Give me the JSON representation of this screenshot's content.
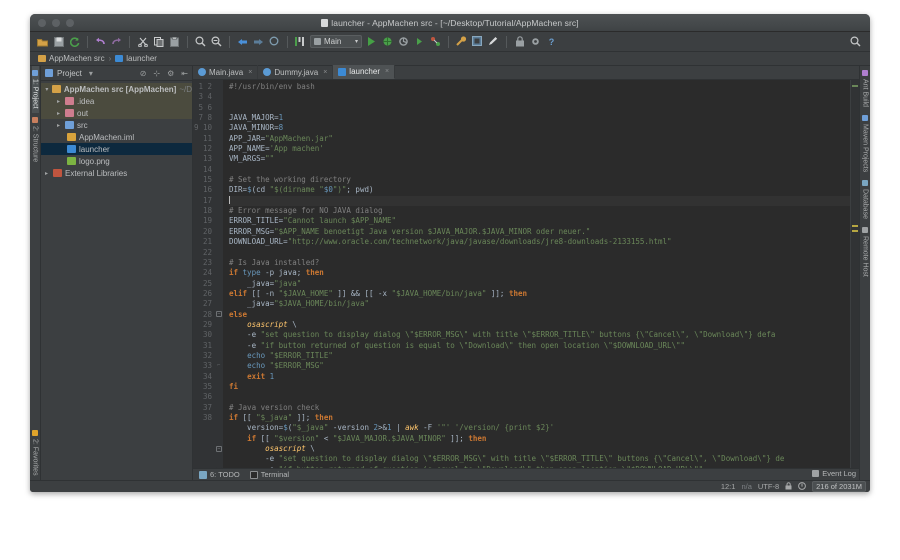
{
  "window": {
    "title": "launcher - AppMachen src - [~/Desktop/Tutorial/AppMachen src]",
    "title_icon": "file-icon"
  },
  "toolbar": {
    "icons": [
      {
        "name": "open-folder-icon",
        "glyph": "▤"
      },
      {
        "name": "save-all-icon",
        "glyph": "▣"
      },
      {
        "name": "sync-icon",
        "glyph": "⟳"
      },
      {
        "name": "undo-icon",
        "glyph": "↶"
      },
      {
        "name": "redo-icon",
        "glyph": "↷"
      },
      {
        "name": "cut-icon",
        "glyph": "✂"
      },
      {
        "name": "copy-icon",
        "glyph": "❐"
      },
      {
        "name": "paste-icon",
        "glyph": "📋"
      },
      {
        "name": "find-icon",
        "glyph": "🔍"
      },
      {
        "name": "replace-icon",
        "glyph": "🔎"
      },
      {
        "name": "back-icon",
        "glyph": "◀"
      },
      {
        "name": "forward-icon",
        "glyph": "▶"
      },
      {
        "name": "last-edit-icon",
        "glyph": "⊙"
      },
      {
        "name": "compile-icon",
        "glyph": "⫼"
      }
    ],
    "run_config": {
      "label": "Main",
      "caret": "▾"
    },
    "run_icons": [
      {
        "name": "run-icon",
        "glyph": "▶"
      },
      {
        "name": "debug-icon",
        "glyph": "⬤"
      },
      {
        "name": "run-coverage-icon",
        "glyph": "⛭"
      },
      {
        "name": "run-with-profiler-icon",
        "glyph": "▷"
      },
      {
        "name": "attach-process-icon",
        "glyph": "⚯"
      },
      {
        "name": "build-icon",
        "glyph": "⚒"
      },
      {
        "name": "sdk-settings-icon",
        "glyph": "▦"
      },
      {
        "name": "edit-icon",
        "glyph": "／"
      },
      {
        "name": "lock-icon",
        "glyph": "🔒"
      },
      {
        "name": "settings-icon",
        "glyph": "⚙"
      },
      {
        "name": "help-icon",
        "glyph": "?"
      },
      {
        "name": "search-everywhere-icon",
        "glyph": "🔍"
      }
    ]
  },
  "breadcrumb": [
    {
      "name": "breadcrumb-appmachen-src",
      "label": "AppMachen src",
      "icon": "folder-icon",
      "color": "#d4a147"
    },
    {
      "name": "breadcrumb-launcher",
      "label": "launcher",
      "icon": "file-icon",
      "color": "#3c8ad4"
    }
  ],
  "left_strip": [
    {
      "name": "tool-tab-project",
      "label": "1: Project",
      "active": true,
      "color": "#6f9fd8"
    },
    {
      "name": "tool-tab-structure",
      "label": "2: Structure",
      "active": false,
      "color": "#c87f5e"
    }
  ],
  "left_strip_bottom": [
    {
      "name": "tool-tab-favorites",
      "label": "2: Favorites",
      "icon": "star-icon",
      "color": "#e0a42b"
    }
  ],
  "right_strip": [
    {
      "name": "tool-tab-ant-build",
      "label": "Ant Build",
      "color": "#b07fd0"
    },
    {
      "name": "tool-tab-maven-projects",
      "label": "Maven Projects",
      "color": "#6f9fd8"
    },
    {
      "name": "tool-tab-database",
      "label": "Database",
      "color": "#7aa6c2"
    },
    {
      "name": "tool-tab-remote-host",
      "label": "Remote Host",
      "color": "#9fa2a4"
    }
  ],
  "project_panel": {
    "title": "Project",
    "caret": "▾",
    "actions": [
      {
        "name": "collapse-all-icon",
        "glyph": "⊘"
      },
      {
        "name": "locate-icon",
        "glyph": "⊹"
      },
      {
        "name": "settings-icon",
        "glyph": "⚙"
      },
      {
        "name": "hide-icon",
        "glyph": "⇤"
      }
    ],
    "tree": [
      {
        "name": "tree-item-appmachen-src",
        "label": "AppMachen src [AppMachen]",
        "suffix": "~/D",
        "indent": 0,
        "arrow": "▾",
        "icon": "module-folder-icon",
        "color": "#d4a147",
        "bold": true,
        "state": "highlight"
      },
      {
        "name": "tree-item-idea",
        "label": ".idea",
        "indent": 1,
        "arrow": "▸",
        "icon": "folder-icon",
        "color": "#cf7d8e",
        "state": "highlight"
      },
      {
        "name": "tree-item-out",
        "label": "out",
        "indent": 1,
        "arrow": "▸",
        "icon": "folder-icon",
        "color": "#cf7d8e",
        "state": "highlight"
      },
      {
        "name": "tree-item-src",
        "label": "src",
        "indent": 1,
        "arrow": "▸",
        "icon": "source-folder-icon",
        "color": "#6f9fd8",
        "state": "normal"
      },
      {
        "name": "tree-item-appmachen-iml",
        "label": "AppMachen.iml",
        "indent": 2,
        "arrow": "",
        "icon": "iml-file-icon",
        "color": "#d9a33c",
        "state": "normal"
      },
      {
        "name": "tree-item-launcher",
        "label": "launcher",
        "indent": 2,
        "arrow": "",
        "icon": "file-icon",
        "color": "#3c8ad4",
        "state": "selected"
      },
      {
        "name": "tree-item-logo-png",
        "label": "logo.png",
        "indent": 2,
        "arrow": "",
        "icon": "image-file-icon",
        "color": "#7cb342",
        "state": "normal"
      },
      {
        "name": "tree-item-external-libraries",
        "label": "External Libraries",
        "indent": 0,
        "arrow": "▸",
        "icon": "libraries-icon",
        "color": "#c0553f",
        "state": "normal"
      }
    ]
  },
  "editor_tabs": [
    {
      "name": "tab-main-java",
      "label": "Main.java",
      "icon": "java-class-icon",
      "active": false,
      "close": "×"
    },
    {
      "name": "tab-dummy-java",
      "label": "Dummy.java",
      "icon": "java-class-icon",
      "active": false,
      "close": "×"
    },
    {
      "name": "tab-launcher",
      "label": "launcher",
      "icon": "shell-file-icon",
      "active": true,
      "close": "×"
    }
  ],
  "editor": {
    "first_line": 1,
    "last_line": 38,
    "current_line": 12,
    "lines": [
      "#!/usr/bin/env bash",
      "",
      "",
      "JAVA_MAJOR=1",
      "JAVA_MINOR=8",
      "APP_JAR=\"AppMachen.jar\"",
      "APP_NAME='App machen'",
      "VM_ARGS=\"\"",
      "",
      "# Set the working directory",
      "DIR=$(cd \"$(dirname \"$0\")\"; pwd)",
      "",
      "# Error message for NO JAVA dialog",
      "ERROR_TITLE=\"Cannot launch $APP_NAME\"",
      "ERROR_MSG=\"$APP_NAME benoetigt Java version $JAVA_MAJOR.$JAVA_MINOR oder neuer.\"",
      "DOWNLOAD_URL=\"http://www.oracle.com/technetwork/java/javase/downloads/jre8-downloads-2133155.html\"",
      "",
      "# Is Java installed?",
      "if type -p java; then",
      "    _java=\"java\"",
      "elif [[ -n \"$JAVA_HOME\" ]] && [[ -x \"$JAVA_HOME/bin/java\" ]]; then",
      "    _java=\"$JAVA_HOME/bin/java\"",
      "else",
      "    osascript \\",
      "    -e \"set question to display dialog \\\"$ERROR_MSG\\\" with title \\\"$ERROR_TITLE\\\" buttons {\\\"Cancel\\\", \\\"Download\\\"} defa",
      "    -e \"if button returned of question is equal to \\\"Download\\\" then open location \\\"$DOWNLOAD_URL\\\"\"",
      "    echo \"$ERROR_TITLE\"",
      "    echo \"$ERROR_MSG\"",
      "    exit 1",
      "fi",
      "",
      "# Java version check",
      "if [[ \"$_java\" ]]; then",
      "    version=$(\"$_java\" -version 2>&1 | awk -F '\"' '/version/ {print $2}'",
      "    if [[ \"$version\" < \"$JAVA_MAJOR.$JAVA_MINOR\" ]]; then",
      "        osascript \\",
      "        -e \"set question to display dialog \\\"$ERROR_MSG\\\" with title \\\"$ERROR_TITLE\\\" buttons {\\\"Cancel\\\", \\\"Download\\\"} de",
      "        -e \"if button returned of question is equal to \\\"Download\\\" then open location \\\"$DOWNLOAD_URL\\\"\""
    ]
  },
  "bottom_tabs": [
    {
      "name": "bottom-tab-todo",
      "label": "6: TODO",
      "icon": "todo-icon"
    },
    {
      "name": "bottom-tab-terminal",
      "label": "Terminal",
      "icon": "terminal-icon"
    }
  ],
  "status_bar": {
    "event_log": "Event Log",
    "caret_position": "12:1",
    "line_separator": "n/a",
    "encoding": "UTF-8",
    "lock_icon": "read-only-lock-icon",
    "inspection_icon": "inspection-icon",
    "memory": "216 of 2031M"
  }
}
